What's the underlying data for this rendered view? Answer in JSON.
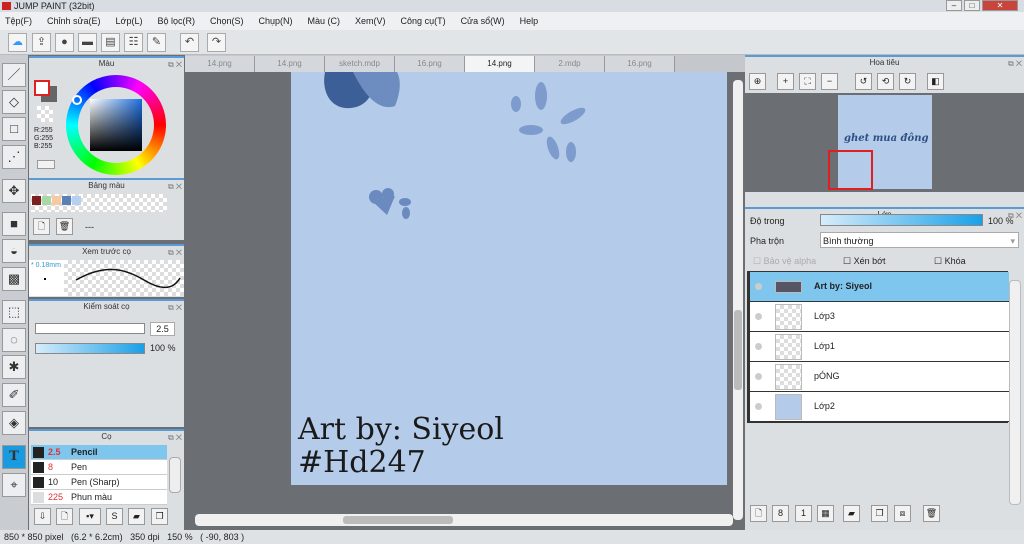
{
  "app": {
    "title": "JUMP PAINT (32bit)"
  },
  "menu": [
    "Tệp(F)",
    "Chỉnh sửa(E)",
    "Lớp(L)",
    "Bộ lọc(R)",
    "Chọn(S)",
    "Chụp(N)",
    "Màu (C)",
    "Xem(V)",
    "Công cụ(T)",
    "Cửa sổ(W)",
    "Help"
  ],
  "toolbar": {
    "icons": [
      "cloud-icon",
      "share-icon",
      "speech-bubble-icon",
      "comment-icon",
      "page-icon",
      "storyboard-icon",
      "edit-panel-icon",
      "undo-icon",
      "redo-icon"
    ]
  },
  "color_panel": {
    "title": "Màu",
    "r": "R:255",
    "g": "G:255",
    "b": "B:255",
    "foreground": "#ffffff",
    "background": "#666666"
  },
  "palette_panel": {
    "title": "Bảng màu",
    "swatches": [
      "#7a2020",
      "#a8d8a8",
      "#f8c8a0",
      "#5a80b8",
      "#b8d0f0"
    ],
    "dash": "---"
  },
  "brush_preview": {
    "title": "Xem trước cọ",
    "size": "* 0.18mm"
  },
  "brush_control": {
    "title": "Kiểm soát cọ",
    "size": "2.5",
    "opacity": "100 %"
  },
  "brush_panel": {
    "title": "Cọ",
    "items": [
      {
        "size": "2.5",
        "name": "Pencil",
        "selected": true
      },
      {
        "size": "8",
        "name": "Pen"
      },
      {
        "size": "10",
        "name": "Pen (Sharp)"
      },
      {
        "size": "225",
        "name": "Phun màu"
      }
    ]
  },
  "tabs": [
    {
      "label": "14.png"
    },
    {
      "label": "14.png"
    },
    {
      "label": "sketch.mdp"
    },
    {
      "label": "16.png"
    },
    {
      "label": "14.png",
      "active": true
    },
    {
      "label": "2.mdp"
    },
    {
      "label": "16.png"
    }
  ],
  "canvas": {
    "line1": "Art by: Siyeol",
    "line2": "#Hd247",
    "background": "#b4cce9"
  },
  "navigator": {
    "title": "Hoa tiêu",
    "thumb_text": "ghet mua đông"
  },
  "layers": {
    "title": "Lớp",
    "opacity_label": "Độ trong",
    "opacity_value": "100 %",
    "blend_label": "Pha trộn",
    "blend_value": "Bình thường",
    "protect_alpha": "Bảo vệ alpha",
    "clipping": "Xén bớt",
    "lock": "Khóa",
    "items": [
      {
        "name": "Art by: Siyeol",
        "selected": true
      },
      {
        "name": "Lớp3"
      },
      {
        "name": "Lớp1"
      },
      {
        "name": "pÓNG"
      },
      {
        "name": "Lớp2"
      }
    ]
  },
  "status": {
    "text": "850 * 850 pixel   (6.2 * 6.2cm)   350 dpi   150 %   ( -90, 803 )"
  }
}
